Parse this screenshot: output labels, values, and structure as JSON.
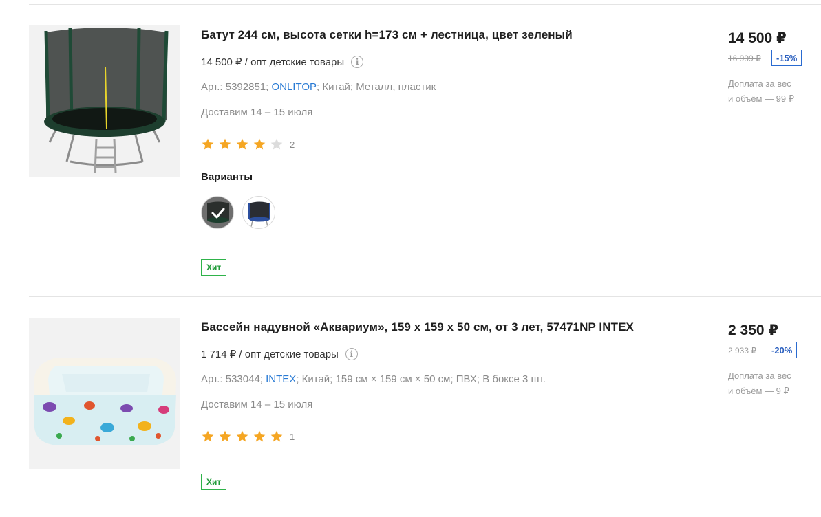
{
  "products": [
    {
      "title": "Батут 244 см, высота сетки h=173 см + лестница, цвет зеленый",
      "wholesale": "14 500 ₽ / опт детские товары",
      "info_icon": "info-icon",
      "attrs": {
        "prefix": "Арт.: 5392851; ",
        "brand": "ONLITOP",
        "suffix": "; Китай; Металл, пластик"
      },
      "delivery": "Доставим 14 – 15 июля",
      "rating": 4,
      "review_count": "2",
      "variants_title": "Варианты",
      "variants": [
        "green-trampoline",
        "blue-trampoline"
      ],
      "badge": "Хит",
      "price": "14 500 ₽",
      "old_price": "16 999 ₽",
      "discount": "-15%",
      "surcharge_line1": "Доплата за вес",
      "surcharge_line2": "и объём — 99 ₽"
    },
    {
      "title": "Бассейн надувной «Аквариум», 159 х 159 х 50 см, от 3 лет, 57471NP INTEX",
      "wholesale": "1 714 ₽ / опт детские товары",
      "info_icon": "info-icon",
      "attrs": {
        "prefix": "Арт.: 533044; ",
        "brand": "INTEX",
        "suffix": "; Китай; 159 см × 159 см × 50 см; ПВХ; В боксе 3 шт."
      },
      "delivery": "Доставим 14 – 15 июля",
      "rating": 5,
      "review_count": "1",
      "badge": "Хит",
      "price": "2 350 ₽",
      "old_price": "2 933 ₽",
      "discount": "-20%",
      "surcharge_line1": "Доплата за вес",
      "surcharge_line2": "и объём — 9 ₽"
    }
  ],
  "colors": {
    "star_filled": "#f5a623",
    "star_empty": "#dcdcdc",
    "brand_link": "#2a7bd4",
    "badge_green": "#2fb34a",
    "discount_blue": "#2a6bd1"
  }
}
